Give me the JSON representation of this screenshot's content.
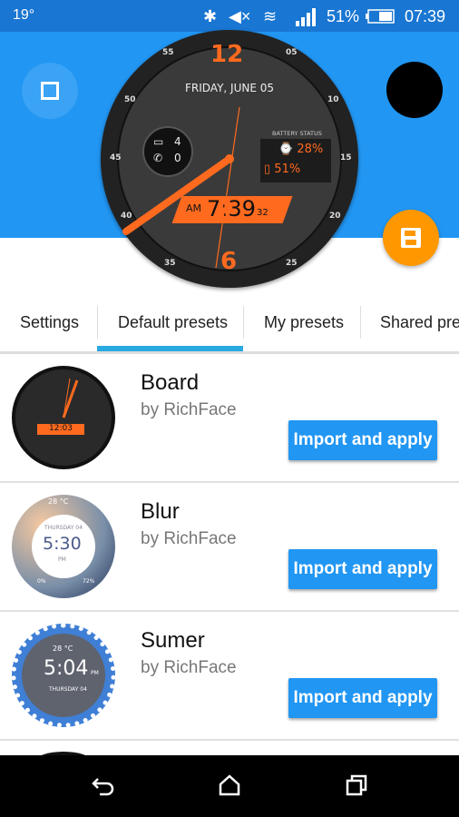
{
  "status_bar": {
    "temperature": "19°",
    "battery": "51%",
    "time": "07:39",
    "icons": [
      "bluetooth-icon",
      "mute-icon",
      "wifi-icon",
      "signal-icon",
      "battery-icon"
    ]
  },
  "watch_preview": {
    "hour_marker_top": "12",
    "hour_marker_bottom": "6",
    "date": "FRIDAY, JUNE 05",
    "battery_label": "BATTERY STATUS",
    "watch_battery": "28%",
    "phone_battery": "51%",
    "messages": "4",
    "calls": "0",
    "ampm": "AM",
    "time": "7:39",
    "seconds": "32",
    "bezel": [
      "55",
      "05",
      "50",
      "10",
      "45",
      "15",
      "40",
      "20",
      "35",
      "25"
    ]
  },
  "colors": {
    "primary": "#2196f3",
    "accent": "#ff9800",
    "watch_accent": "#ff6a1f"
  },
  "tabs": [
    {
      "label": "Settings"
    },
    {
      "label": "Default presets",
      "selected": true
    },
    {
      "label": "My presets"
    },
    {
      "label": "Shared presets"
    }
  ],
  "presets": [
    {
      "title": "Board",
      "author": "by RichFace",
      "button": "Import and apply",
      "thumb": {
        "time": "12:03"
      }
    },
    {
      "title": "Blur",
      "author": "by RichFace",
      "button": "Import and apply",
      "thumb": {
        "temp": "28 °C",
        "day": "THURSDAY 04",
        "time": "5:30",
        "ampm": "PM",
        "left": "0%",
        "right": "72%"
      }
    },
    {
      "title": "Sumer",
      "author": "by RichFace",
      "button": "Import and apply",
      "thumb": {
        "temp": "28 °C",
        "day": "THURSDAY 04",
        "time": "5:04",
        "ampm": "PM"
      }
    }
  ]
}
